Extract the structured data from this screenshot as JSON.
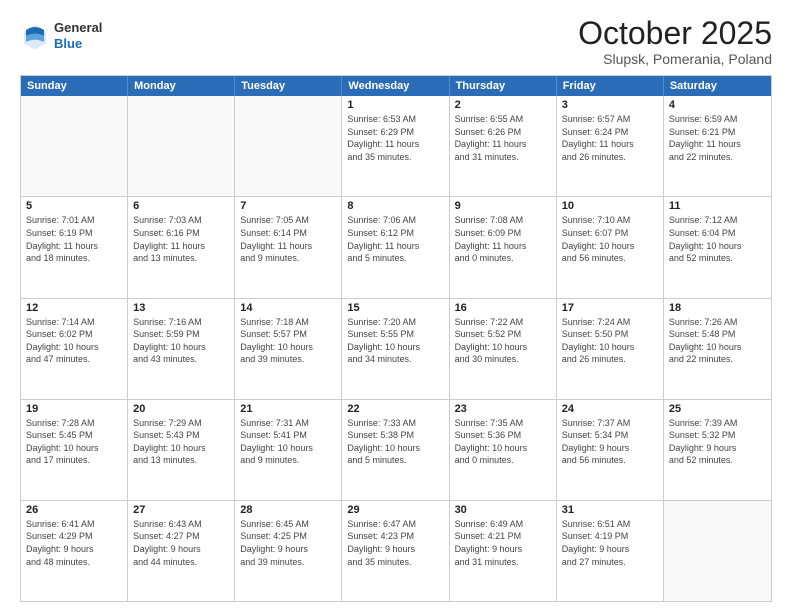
{
  "header": {
    "logo": {
      "general": "General",
      "blue": "Blue"
    },
    "title": "October 2025",
    "subtitle": "Slupsk, Pomerania, Poland"
  },
  "weekdays": [
    "Sunday",
    "Monday",
    "Tuesday",
    "Wednesday",
    "Thursday",
    "Friday",
    "Saturday"
  ],
  "rows": [
    [
      {
        "day": "",
        "info": ""
      },
      {
        "day": "",
        "info": ""
      },
      {
        "day": "",
        "info": ""
      },
      {
        "day": "1",
        "info": "Sunrise: 6:53 AM\nSunset: 6:29 PM\nDaylight: 11 hours\nand 35 minutes."
      },
      {
        "day": "2",
        "info": "Sunrise: 6:55 AM\nSunset: 6:26 PM\nDaylight: 11 hours\nand 31 minutes."
      },
      {
        "day": "3",
        "info": "Sunrise: 6:57 AM\nSunset: 6:24 PM\nDaylight: 11 hours\nand 26 minutes."
      },
      {
        "day": "4",
        "info": "Sunrise: 6:59 AM\nSunset: 6:21 PM\nDaylight: 11 hours\nand 22 minutes."
      }
    ],
    [
      {
        "day": "5",
        "info": "Sunrise: 7:01 AM\nSunset: 6:19 PM\nDaylight: 11 hours\nand 18 minutes."
      },
      {
        "day": "6",
        "info": "Sunrise: 7:03 AM\nSunset: 6:16 PM\nDaylight: 11 hours\nand 13 minutes."
      },
      {
        "day": "7",
        "info": "Sunrise: 7:05 AM\nSunset: 6:14 PM\nDaylight: 11 hours\nand 9 minutes."
      },
      {
        "day": "8",
        "info": "Sunrise: 7:06 AM\nSunset: 6:12 PM\nDaylight: 11 hours\nand 5 minutes."
      },
      {
        "day": "9",
        "info": "Sunrise: 7:08 AM\nSunset: 6:09 PM\nDaylight: 11 hours\nand 0 minutes."
      },
      {
        "day": "10",
        "info": "Sunrise: 7:10 AM\nSunset: 6:07 PM\nDaylight: 10 hours\nand 56 minutes."
      },
      {
        "day": "11",
        "info": "Sunrise: 7:12 AM\nSunset: 6:04 PM\nDaylight: 10 hours\nand 52 minutes."
      }
    ],
    [
      {
        "day": "12",
        "info": "Sunrise: 7:14 AM\nSunset: 6:02 PM\nDaylight: 10 hours\nand 47 minutes."
      },
      {
        "day": "13",
        "info": "Sunrise: 7:16 AM\nSunset: 5:59 PM\nDaylight: 10 hours\nand 43 minutes."
      },
      {
        "day": "14",
        "info": "Sunrise: 7:18 AM\nSunset: 5:57 PM\nDaylight: 10 hours\nand 39 minutes."
      },
      {
        "day": "15",
        "info": "Sunrise: 7:20 AM\nSunset: 5:55 PM\nDaylight: 10 hours\nand 34 minutes."
      },
      {
        "day": "16",
        "info": "Sunrise: 7:22 AM\nSunset: 5:52 PM\nDaylight: 10 hours\nand 30 minutes."
      },
      {
        "day": "17",
        "info": "Sunrise: 7:24 AM\nSunset: 5:50 PM\nDaylight: 10 hours\nand 26 minutes."
      },
      {
        "day": "18",
        "info": "Sunrise: 7:26 AM\nSunset: 5:48 PM\nDaylight: 10 hours\nand 22 minutes."
      }
    ],
    [
      {
        "day": "19",
        "info": "Sunrise: 7:28 AM\nSunset: 5:45 PM\nDaylight: 10 hours\nand 17 minutes."
      },
      {
        "day": "20",
        "info": "Sunrise: 7:29 AM\nSunset: 5:43 PM\nDaylight: 10 hours\nand 13 minutes."
      },
      {
        "day": "21",
        "info": "Sunrise: 7:31 AM\nSunset: 5:41 PM\nDaylight: 10 hours\nand 9 minutes."
      },
      {
        "day": "22",
        "info": "Sunrise: 7:33 AM\nSunset: 5:38 PM\nDaylight: 10 hours\nand 5 minutes."
      },
      {
        "day": "23",
        "info": "Sunrise: 7:35 AM\nSunset: 5:36 PM\nDaylight: 10 hours\nand 0 minutes."
      },
      {
        "day": "24",
        "info": "Sunrise: 7:37 AM\nSunset: 5:34 PM\nDaylight: 9 hours\nand 56 minutes."
      },
      {
        "day": "25",
        "info": "Sunrise: 7:39 AM\nSunset: 5:32 PM\nDaylight: 9 hours\nand 52 minutes."
      }
    ],
    [
      {
        "day": "26",
        "info": "Sunrise: 6:41 AM\nSunset: 4:29 PM\nDaylight: 9 hours\nand 48 minutes."
      },
      {
        "day": "27",
        "info": "Sunrise: 6:43 AM\nSunset: 4:27 PM\nDaylight: 9 hours\nand 44 minutes."
      },
      {
        "day": "28",
        "info": "Sunrise: 6:45 AM\nSunset: 4:25 PM\nDaylight: 9 hours\nand 39 minutes."
      },
      {
        "day": "29",
        "info": "Sunrise: 6:47 AM\nSunset: 4:23 PM\nDaylight: 9 hours\nand 35 minutes."
      },
      {
        "day": "30",
        "info": "Sunrise: 6:49 AM\nSunset: 4:21 PM\nDaylight: 9 hours\nand 31 minutes."
      },
      {
        "day": "31",
        "info": "Sunrise: 6:51 AM\nSunset: 4:19 PM\nDaylight: 9 hours\nand 27 minutes."
      },
      {
        "day": "",
        "info": ""
      }
    ]
  ]
}
